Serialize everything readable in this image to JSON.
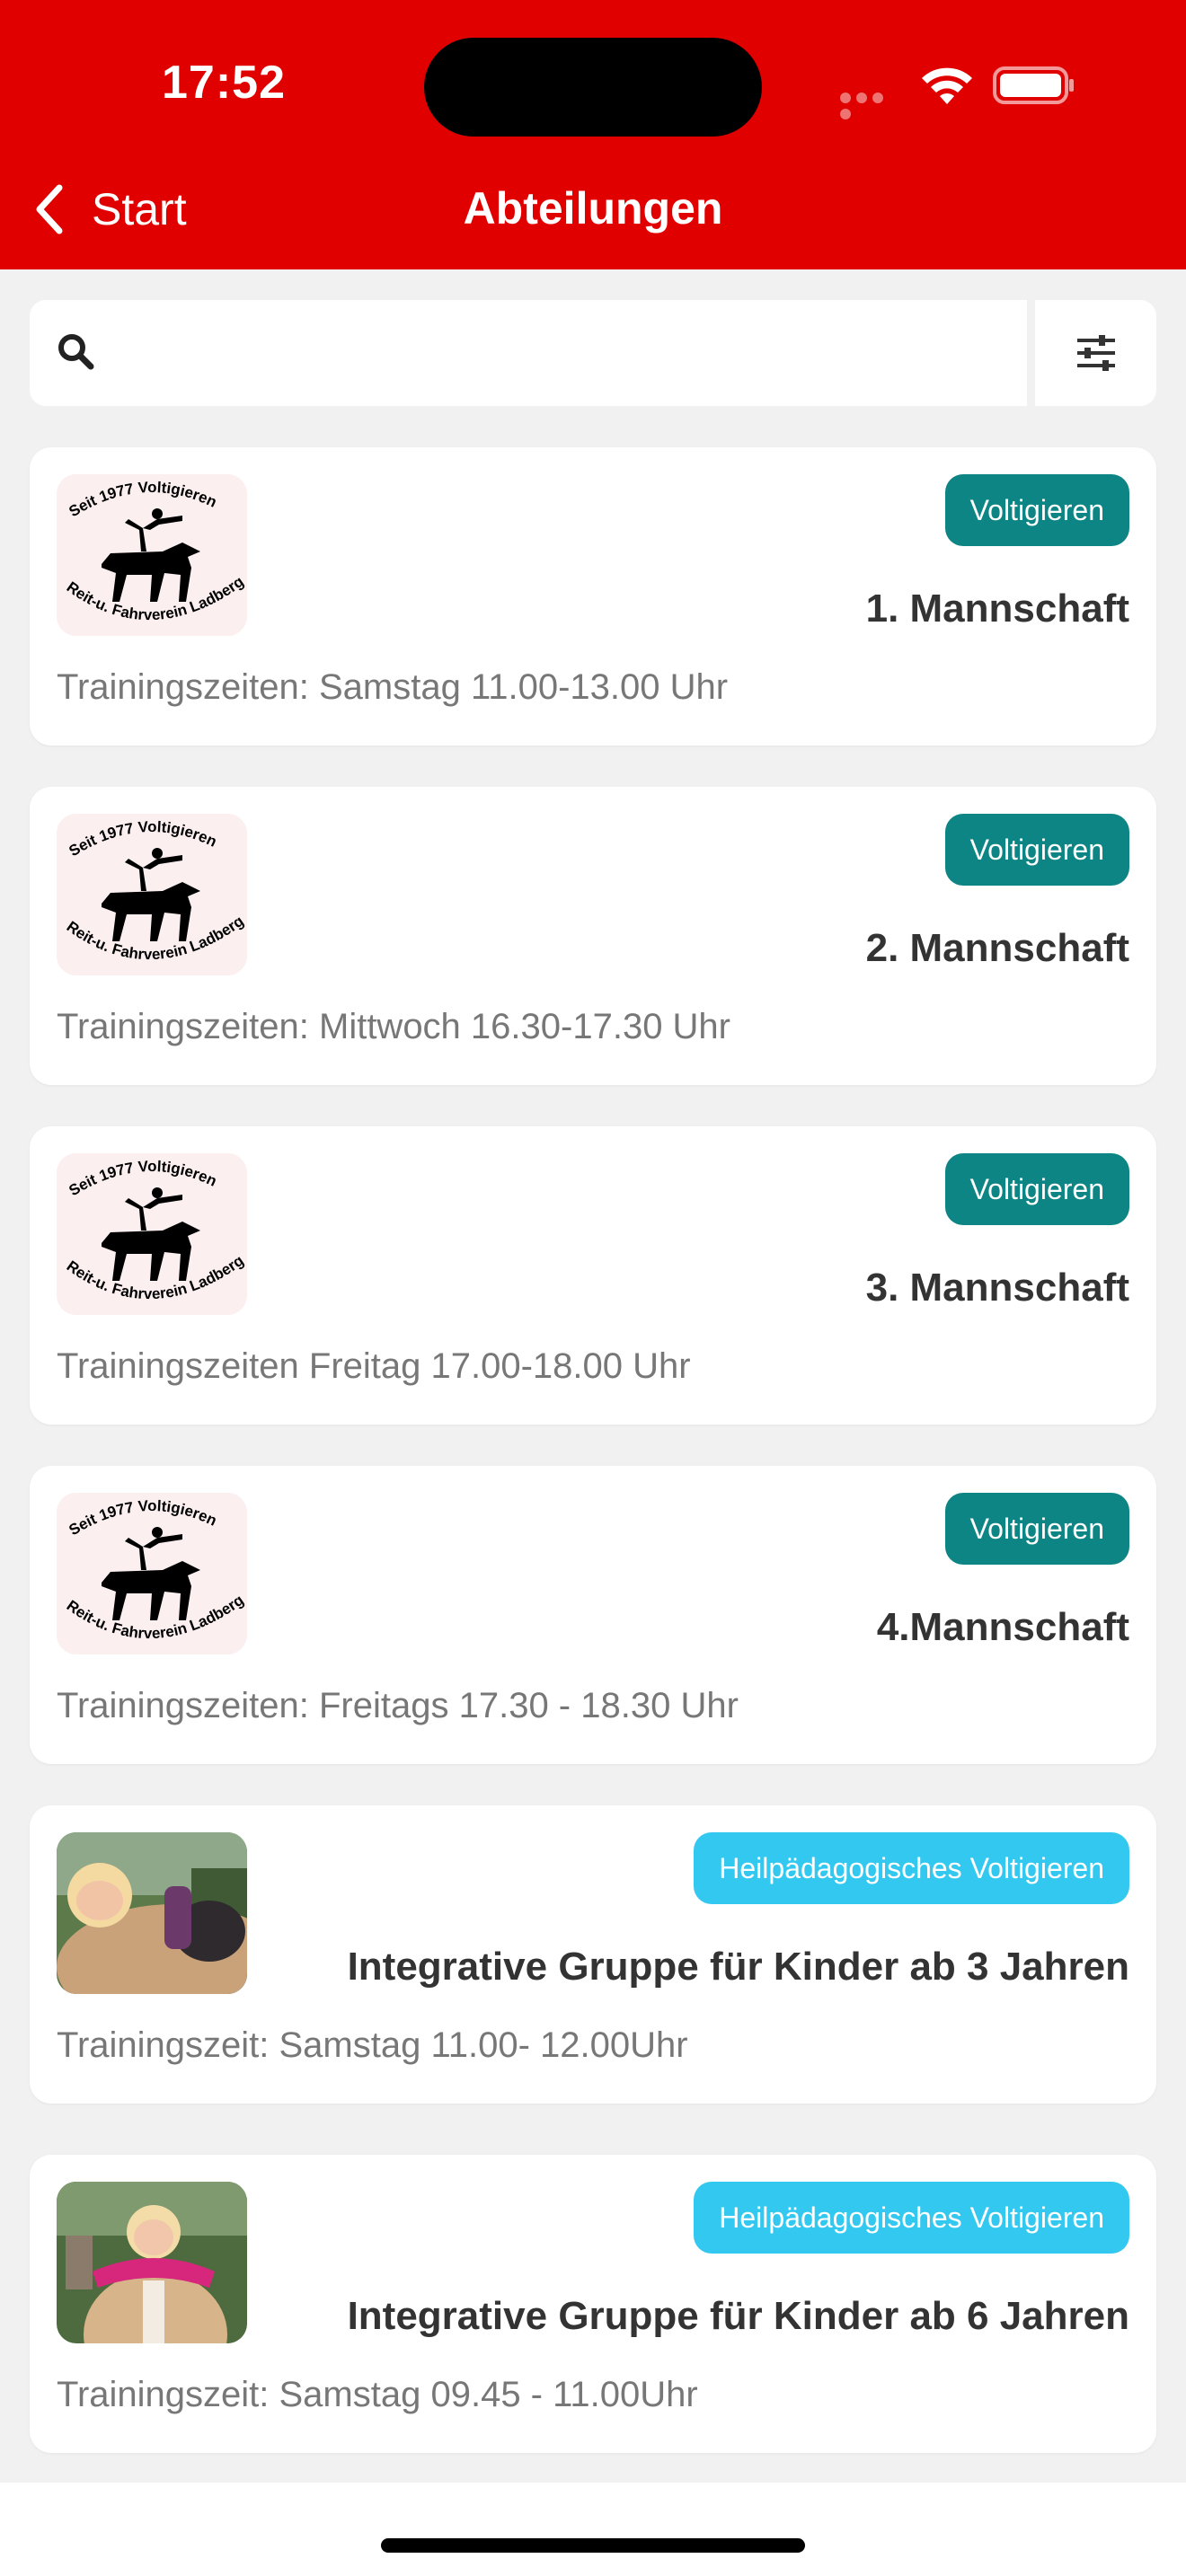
{
  "status_bar": {
    "time": "17:52"
  },
  "nav": {
    "back_label": "Start",
    "title": "Abteilungen"
  },
  "search": {
    "placeholder": "",
    "value": ""
  },
  "colors": {
    "header": "#e10000",
    "badge_voltigieren": "#0d8585",
    "badge_heil": "#33c8f0"
  },
  "cards": [
    {
      "logo": "Voltigier-Logo",
      "logo_text_top": "Seit 1977 Voltigieren",
      "logo_text_bottom": "Reit-u. Fahrverein Ladbergen",
      "badge": "Voltigieren",
      "title": "1. Mannschaft",
      "subtitle": "Trainingszeiten: Samstag 11.00-13.00 Uhr"
    },
    {
      "logo": "Voltigier-Logo",
      "logo_text_top": "Seit 1977 Voltigieren",
      "logo_text_bottom": "Reit-u. Fahrverein Ladbergen",
      "badge": "Voltigieren",
      "title": "2. Mannschaft",
      "subtitle": "Trainingszeiten: Mittwoch 16.30-17.30 Uhr"
    },
    {
      "logo": "Voltigier-Logo",
      "logo_text_top": "Seit 1977 Voltigieren",
      "logo_text_bottom": "Reit-u. Fahrverein Ladbergen",
      "badge": "Voltigieren",
      "title": "3. Mannschaft",
      "subtitle": "Trainingszeiten Freitag 17.00-18.00 Uhr"
    },
    {
      "logo": "Voltigier-Logo",
      "logo_text_top": "Seit 1977 Voltigieren",
      "logo_text_bottom": "Reit-u. Fahrverein Ladbergen",
      "badge": "Voltigieren",
      "title": "4.Mannschaft",
      "subtitle": "Trainingszeiten: Freitags 17.30 - 18.30 Uhr"
    },
    {
      "logo": "photo",
      "badge": "Heilpädagogisches Voltigieren",
      "title": "Integrative Gruppe für Kinder ab 3 Jahren",
      "subtitle": "Trainingszeit: Samstag 11.00- 12.00Uhr"
    },
    {
      "logo": "photo",
      "badge": "Heilpädagogisches Voltigieren",
      "title": "Integrative Gruppe für Kinder ab 6 Jahren",
      "subtitle": "Trainingszeit: Samstag 09.45 - 11.00Uhr"
    }
  ]
}
